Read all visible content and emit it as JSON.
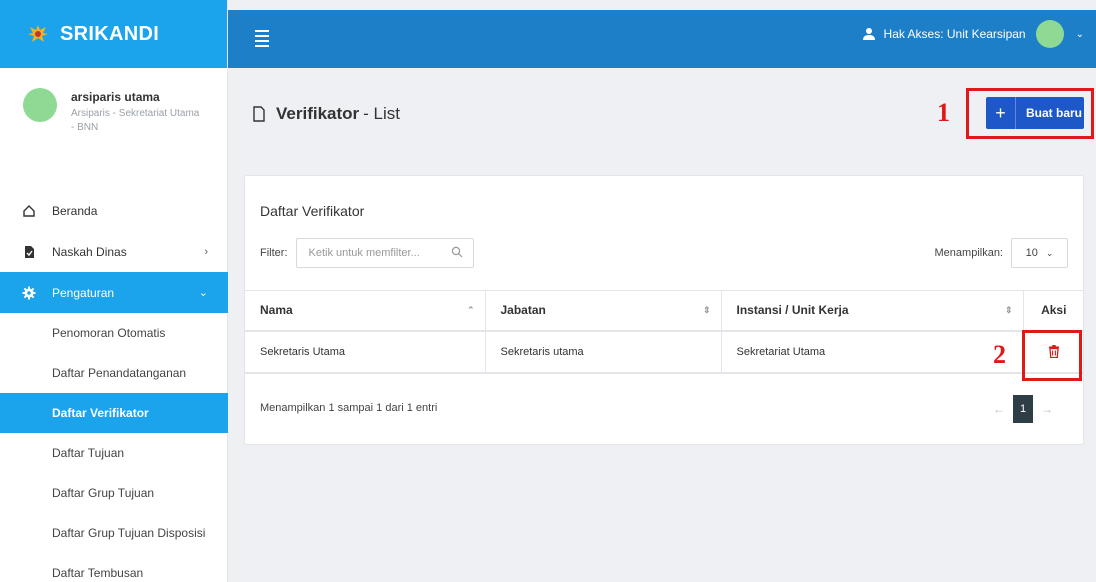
{
  "brand": {
    "name": "SRIKANDI"
  },
  "user": {
    "name": "arsiparis utama",
    "role": "Arsiparis - Sekretariat Utama - BNN"
  },
  "menu": {
    "items": [
      {
        "label": "Beranda"
      },
      {
        "label": "Naskah Dinas"
      },
      {
        "label": "Pengaturan"
      }
    ],
    "submenu": [
      {
        "label": "Penomoran Otomatis"
      },
      {
        "label": "Daftar Penandatanganan"
      },
      {
        "label": "Daftar Verifikator"
      },
      {
        "label": "Daftar Tujuan"
      },
      {
        "label": "Daftar Grup Tujuan"
      },
      {
        "label": "Daftar Grup Tujuan Disposisi"
      },
      {
        "label": "Daftar Tembusan"
      }
    ]
  },
  "topbar": {
    "access_label": "Hak Akses: Unit Kearsipan"
  },
  "page": {
    "title_main": "Verifikator",
    "title_sub": "- List"
  },
  "actions": {
    "new_label": "Buat baru"
  },
  "markers": {
    "one": "1",
    "two": "2"
  },
  "card": {
    "title": "Daftar Verifikator",
    "filter_label": "Filter:",
    "filter_placeholder": "Ketik untuk memfilter...",
    "show_label": "Menampilkan:",
    "show_value": "10",
    "columns": [
      "Nama",
      "Jabatan",
      "Instansi / Unit Kerja",
      "Aksi"
    ],
    "rows": [
      [
        "Sekretaris Utama",
        "Sekretaris utama",
        "Sekretariat Utama"
      ]
    ],
    "info": "Menampilkan 1 sampai 1 dari 1 entri",
    "pager": {
      "prev": "←",
      "current": "1",
      "next": "→"
    }
  },
  "colors": {
    "brand": "#1ba3ec",
    "topbar": "#1e7fc9",
    "primary_button": "#1e57c8",
    "danger": "#e01818"
  }
}
